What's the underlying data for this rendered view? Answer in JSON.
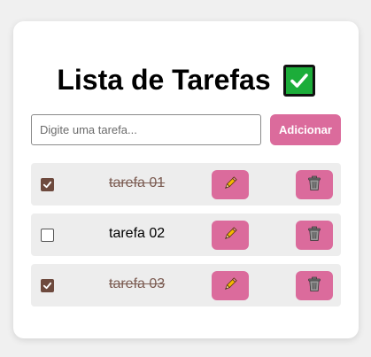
{
  "app": {
    "title": "Lista de Tarefas",
    "title_icon": "check-mark-button-icon"
  },
  "form": {
    "input_placeholder": "Digite uma tarefa...",
    "input_value": "",
    "add_label": "Adicionar"
  },
  "tasks": [
    {
      "text": "tarefa 01",
      "completed": true,
      "edit_icon": "pencil-icon",
      "delete_icon": "trash-icon"
    },
    {
      "text": "tarefa 02",
      "completed": false,
      "edit_icon": "pencil-icon",
      "delete_icon": "trash-icon"
    },
    {
      "text": "tarefa 03",
      "completed": true,
      "edit_icon": "pencil-icon",
      "delete_icon": "trash-icon"
    }
  ],
  "colors": {
    "accent": "#db6b9c",
    "checkbox_checked": "#6e4a3e",
    "task_bg": "#ededed",
    "page_bg": "#f0f0f0",
    "done_text": "#7a5a50"
  }
}
